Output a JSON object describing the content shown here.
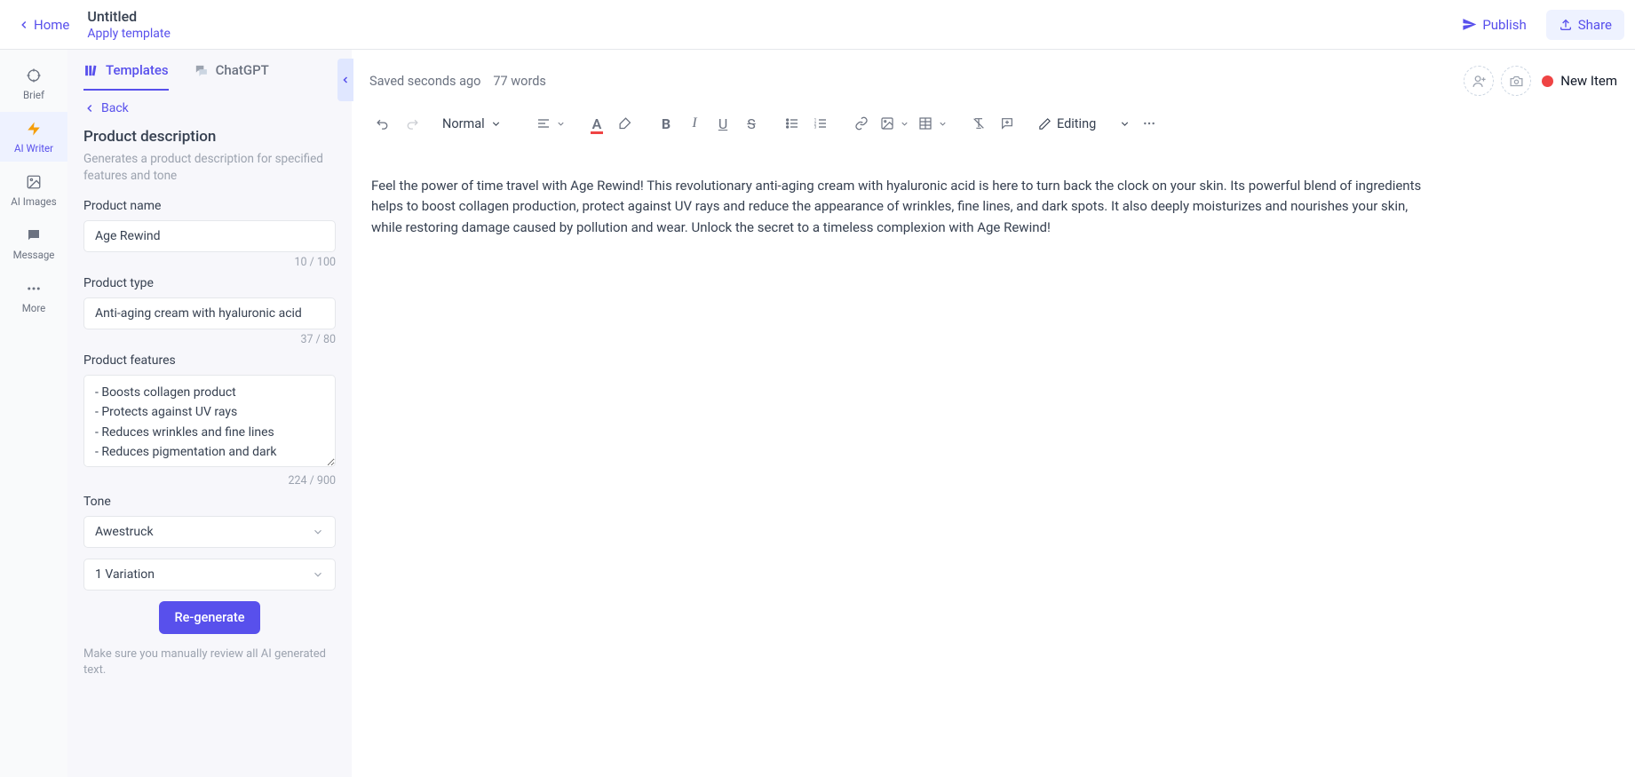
{
  "header": {
    "home_label": "Home",
    "title": "Untitled",
    "apply_template_label": "Apply template",
    "publish_label": "Publish",
    "share_label": "Share"
  },
  "left_nav": {
    "items": [
      "Brief",
      "AI Writer",
      "AI Images",
      "Message",
      "More"
    ]
  },
  "sidebar": {
    "tabs": {
      "templates": "Templates",
      "chatgpt": "ChatGPT"
    },
    "back_label": "Back",
    "panel_title": "Product description",
    "panel_desc": "Generates a product description for specified features and tone",
    "product_name": {
      "label": "Product name",
      "value": "Age Rewind",
      "counter": "10 / 100"
    },
    "product_type": {
      "label": "Product type",
      "value": "Anti-aging cream with hyaluronic acid",
      "counter": "37 / 80"
    },
    "product_features": {
      "label": "Product features",
      "value": "- Boosts collagen product\n- Protects against UV rays\n- Reduces wrinkles and fine lines\n- Reduces pigmentation and dark",
      "counter": "224 / 900"
    },
    "tone": {
      "label": "Tone",
      "value": "Awestruck"
    },
    "variations": {
      "value": "1 Variation"
    },
    "regenerate_label": "Re-generate",
    "review_note": "Make sure you manually review all AI generated text."
  },
  "editor": {
    "saved_text": "Saved seconds ago",
    "word_count": "77 words",
    "new_item_label": "New Item",
    "format_dropdown": "Normal",
    "editing_dropdown": "Editing",
    "body_text": "Feel the power of time travel with Age Rewind! This revolutionary anti-aging cream with hyaluronic acid is here to turn back the clock on your skin. Its powerful blend of ingredients helps to boost collagen production, protect against UV rays and reduce the appearance of wrinkles, fine lines, and dark spots. It also deeply moisturizes and nourishes your skin, while restoring damage caused by pollution and wear. Unlock the secret to a timeless complexion with Age Rewind!"
  }
}
